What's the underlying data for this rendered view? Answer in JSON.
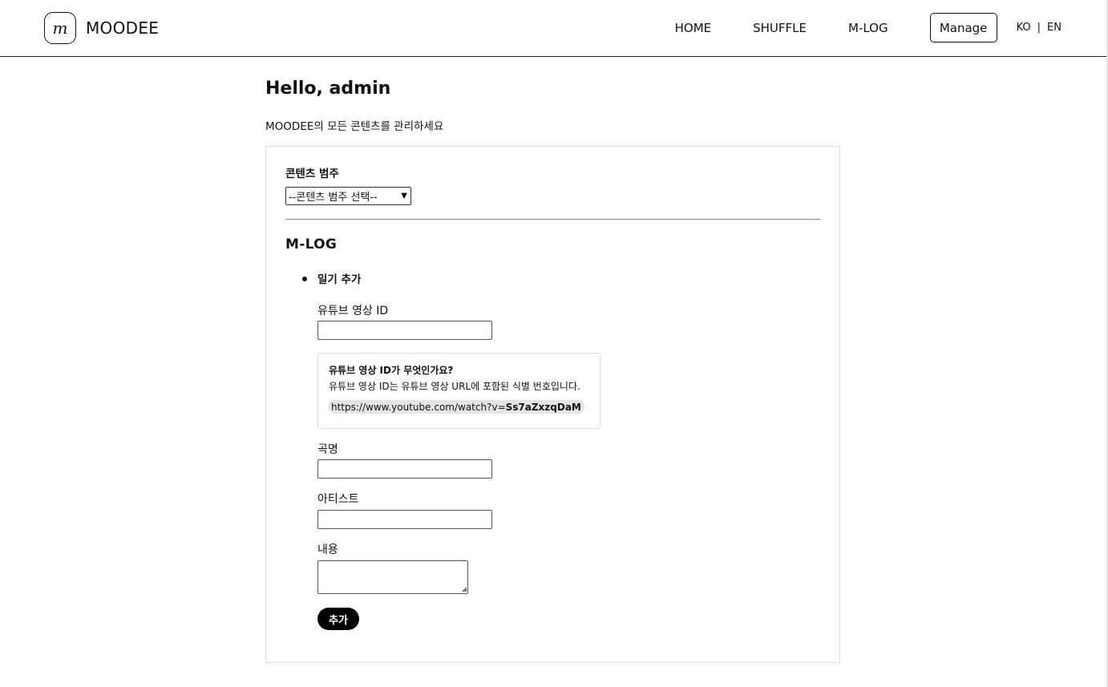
{
  "header": {
    "logo_mark": "m",
    "logo_text": "MOODEE",
    "nav": [
      "HOME",
      "SHUFFLE",
      "M-LOG"
    ],
    "manage_label": "Manage",
    "lang": {
      "ko": "KO",
      "sep": "|",
      "en": "EN"
    }
  },
  "main": {
    "greeting": "Hello, admin",
    "subtitle": "MOODEE의 모든 콘텐츠를 관리하세요"
  },
  "category": {
    "label": "콘텐츠 범주",
    "selected": "--콘텐츠 범주 선택--"
  },
  "section": {
    "title": "M-LOG",
    "list_item": "일기 추가"
  },
  "form": {
    "video_id_label": "유튜브 영상 ID",
    "video_id_value": "",
    "title_label": "곡명",
    "title_value": "",
    "artist_label": "아티스트",
    "artist_value": "",
    "content_label": "내용",
    "content_value": "",
    "submit_label": "추가"
  },
  "info": {
    "title": "유튜브 영상 ID가 무엇인가요?",
    "desc": "유튜브 영상 ID는 유튜브 영상 URL에 포함된 식별 번호입니다.",
    "url_prefix": "https://www.youtube.com/watch?v=",
    "url_id": "Ss7aZxzqDaM"
  },
  "icons": {
    "select_arrow": "chevron-down-icon",
    "textarea_handle": "resize-handle-icon"
  },
  "colors": {
    "primary_button": "#000000",
    "url_highlight": "#e4e4e4",
    "border": "#dddddd"
  }
}
